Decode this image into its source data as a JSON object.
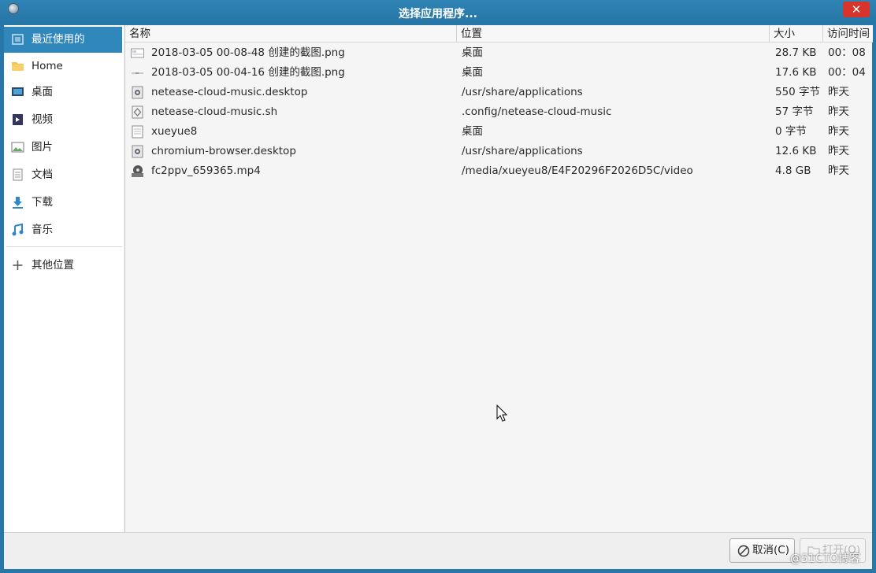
{
  "window": {
    "title": "选择应用程序..."
  },
  "sidebar": {
    "items": [
      {
        "label": "最近使用的",
        "icon": "recent-icon",
        "selected": true
      },
      {
        "label": "Home",
        "icon": "folder-icon"
      },
      {
        "label": "桌面",
        "icon": "desktop-icon"
      },
      {
        "label": "视频",
        "icon": "video-icon"
      },
      {
        "label": "图片",
        "icon": "picture-icon"
      },
      {
        "label": "文档",
        "icon": "document-icon"
      },
      {
        "label": "下载",
        "icon": "download-icon"
      },
      {
        "label": "音乐",
        "icon": "music-icon"
      }
    ],
    "other_locations": {
      "label": "其他位置",
      "icon": "plus-icon"
    }
  },
  "columns": {
    "name": "名称",
    "location": "位置",
    "size": "大小",
    "time": "访问时间"
  },
  "files": [
    {
      "name": "2018-03-05 00-08-48 创建的截图.png",
      "location": "桌面",
      "size": "28.7 KB",
      "time": "00：08",
      "icon": "image-file-icon"
    },
    {
      "name": "2018-03-05 00-04-16 创建的截图.png",
      "location": "桌面",
      "size": "17.6 KB",
      "time": "00：04",
      "icon": "image-file-icon"
    },
    {
      "name": "netease-cloud-music.desktop",
      "location": "/usr/share/applications",
      "size": "550 字节",
      "time": "昨天",
      "icon": "desktop-file-icon"
    },
    {
      "name": "netease-cloud-music.sh",
      "location": ".config/netease-cloud-music",
      "size": "57 字节",
      "time": "昨天",
      "icon": "script-file-icon"
    },
    {
      "name": "xueyue8",
      "location": "桌面",
      "size": "0 字节",
      "time": "昨天",
      "icon": "text-file-icon"
    },
    {
      "name": "chromium-browser.desktop",
      "location": "/usr/share/applications",
      "size": "12.6 KB",
      "time": "昨天",
      "icon": "desktop-file-icon"
    },
    {
      "name": "fc2ppv_659365.mp4",
      "location": "/media/xueyeu8/E4F20296F2026D5C/video",
      "size": "4.8 GB",
      "time": "昨天",
      "icon": "video-file-icon"
    }
  ],
  "buttons": {
    "cancel": "取消(C)",
    "open": "打开(O)"
  },
  "watermark": "@51CTO博客"
}
